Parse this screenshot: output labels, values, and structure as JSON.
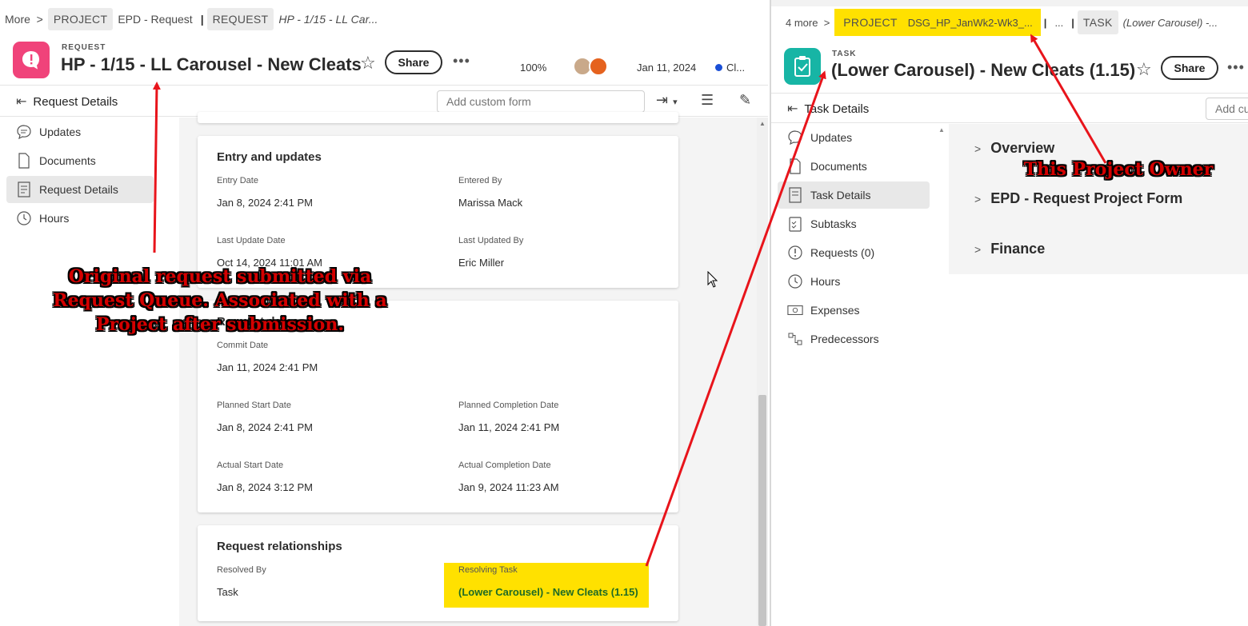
{
  "left": {
    "breadcrumb": {
      "more": "More",
      "project_tag": "PROJECT",
      "project_name": "EPD - Request",
      "request_tag": "REQUEST",
      "request_name": "HP - 1/15 - LL Car..."
    },
    "header": {
      "object_type": "REQUEST",
      "title": "HP - 1/15 - LL Carousel - New Cleats",
      "share_label": "Share",
      "percent": "100%",
      "date": "Jan 11, 2024",
      "status": "Cl..."
    },
    "toolbar": {
      "title": "Request Details",
      "custom_form_placeholder": "Add custom form"
    },
    "nav": [
      {
        "label": "Updates"
      },
      {
        "label": "Documents"
      },
      {
        "label": "Request Details"
      },
      {
        "label": "Hours"
      }
    ],
    "entry_card": {
      "title": "Entry and updates",
      "entry_date_label": "Entry Date",
      "entry_date": "Jan 8, 2024 2:41 PM",
      "entered_by_label": "Entered By",
      "entered_by": "Marissa Mack",
      "last_update_label": "Last Update Date",
      "last_update": "Oct 14, 2024 11:01 AM",
      "last_updated_by_label": "Last Updated By",
      "last_updated_by": "Eric Miller"
    },
    "dates_card": {
      "title": "Request dates",
      "commit_label": "Commit Date",
      "commit": "Jan 11, 2024 2:41 PM",
      "planned_start_label": "Planned Start Date",
      "planned_start": "Jan 8, 2024 2:41 PM",
      "planned_completion_label": "Planned Completion Date",
      "planned_completion": "Jan 11, 2024 2:41 PM",
      "actual_start_label": "Actual Start Date",
      "actual_start": "Jan 8, 2024 3:12 PM",
      "actual_completion_label": "Actual Completion Date",
      "actual_completion": "Jan 9, 2024 11:23 AM"
    },
    "relations_card": {
      "title": "Request relationships",
      "resolved_by_label": "Resolved By",
      "resolved_by": "Task",
      "resolving_task_label": "Resolving Task",
      "resolving_task": "(Lower Carousel) - New Cleats (1.15)"
    }
  },
  "right": {
    "breadcrumb": {
      "more": "4 more",
      "project_tag": "PROJECT",
      "project_name": "DSG_HP_JanWk2-Wk3_...",
      "ellipsis": "...",
      "task_tag": "TASK",
      "task_name": "(Lower Carousel) -..."
    },
    "header": {
      "object_type": "TASK",
      "title": "(Lower Carousel) - New Cleats (1.15)",
      "share_label": "Share"
    },
    "toolbar": {
      "title": "Task Details",
      "custom_form_placeholder": "Add custom form"
    },
    "nav": [
      {
        "label": "Updates"
      },
      {
        "label": "Documents"
      },
      {
        "label": "Task Details"
      },
      {
        "label": "Subtasks"
      },
      {
        "label": "Requests (0)"
      },
      {
        "label": "Hours"
      },
      {
        "label": "Expenses"
      },
      {
        "label": "Predecessors"
      }
    ],
    "sections": [
      {
        "label": "Overview"
      },
      {
        "label": "EPD - Request Project Form"
      },
      {
        "label": "Finance"
      }
    ]
  },
  "annotations": {
    "left_note": "Original request submitted via Request Queue. Associated with a Project after submission.",
    "right_note": "This Project Owner"
  },
  "colors": {
    "request_icon": "#f0437a",
    "task_icon": "#17b5a5",
    "highlight": "#ffe100",
    "annotation_red": "#d40000",
    "task_link_green": "#1e6a26",
    "status_blue": "#1a4fd6"
  }
}
